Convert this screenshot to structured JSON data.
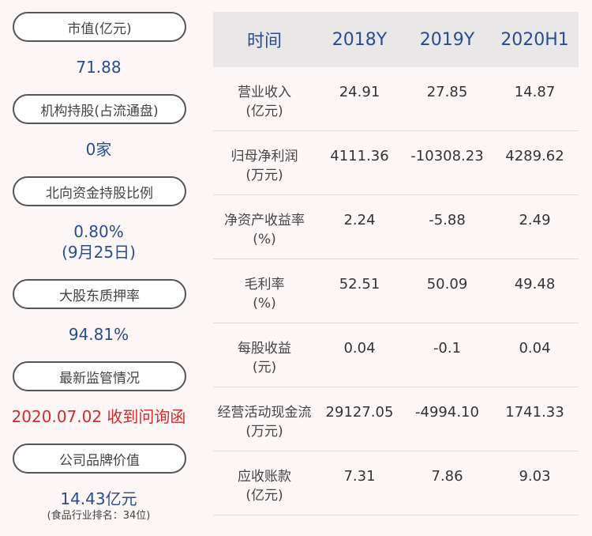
{
  "left": {
    "items": [
      {
        "label": "市值(亿元)",
        "value": "71.88"
      },
      {
        "label": "机构持股(占流通盘)",
        "value": "0家"
      },
      {
        "label": "北向资金持股比例",
        "value": "0.80%",
        "value2": "(9月25日)"
      },
      {
        "label": "大股东质押率",
        "value": "94.81%"
      },
      {
        "label": "最新监管情况",
        "value": "2020.07.02 收到问询函"
      },
      {
        "label": "公司品牌价值",
        "value": "14.43亿元",
        "note": "(食品行业排名：34位)"
      }
    ]
  },
  "table": {
    "headers": [
      "时间",
      "2018Y",
      "2019Y",
      "2020H1"
    ],
    "rows": [
      {
        "label1": "营业收入",
        "label2": "(亿元)",
        "values": [
          "24.91",
          "27.85",
          "14.87"
        ]
      },
      {
        "label1": "归母净利润",
        "label2": "(万元)",
        "values": [
          "4111.36",
          "-10308.23",
          "4289.62"
        ]
      },
      {
        "label1": "净资产收益率",
        "label2": "(%)",
        "values": [
          "2.24",
          "-5.88",
          "2.49"
        ]
      },
      {
        "label1": "毛利率",
        "label2": "(%)",
        "values": [
          "52.51",
          "50.09",
          "49.48"
        ]
      },
      {
        "label1": "每股收益",
        "label2": "(元)",
        "values": [
          "0.04",
          "-0.1",
          "0.04"
        ]
      },
      {
        "label1": "经营活动现金流",
        "label2": "(万元)",
        "values": [
          "29127.05",
          "-4994.10",
          "1741.33"
        ]
      },
      {
        "label1": "应收账款",
        "label2": "(亿元)",
        "values": [
          "7.31",
          "7.86",
          "9.03"
        ]
      }
    ]
  },
  "colors": {
    "value_blue": "#2a4d8f",
    "alert_red": "#d62a2a",
    "header_bg": "#eae7e9",
    "page_bg": "#fcf6f6"
  }
}
